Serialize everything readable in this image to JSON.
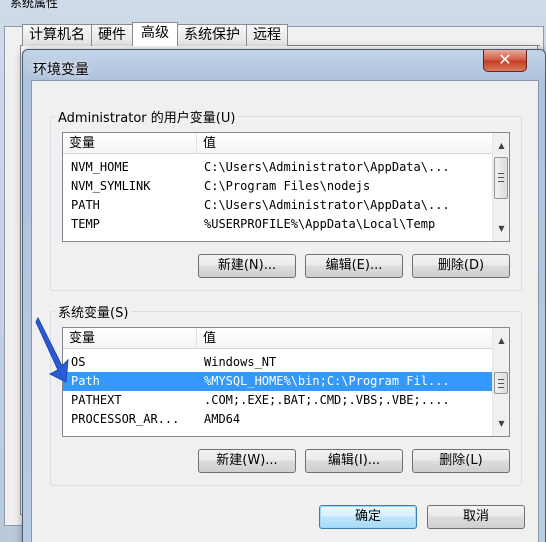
{
  "background_window": {
    "title": "系统属性",
    "tabs": [
      "计算机名",
      "硬件",
      "高级",
      "系统保护",
      "远程"
    ],
    "active_tab": "高级"
  },
  "dialog": {
    "title": "环境变量",
    "close_label": "✕",
    "user_vars": {
      "label": "Administrator 的用户变量(U)",
      "headers": {
        "name": "变量",
        "value": "值"
      },
      "rows": [
        {
          "name": "NVM_HOME",
          "value": "C:\\Users\\Administrator\\AppData\\..."
        },
        {
          "name": "NVM_SYMLINK",
          "value": "C:\\Program Files\\nodejs"
        },
        {
          "name": "PATH",
          "value": "C:\\Users\\Administrator\\AppData\\..."
        },
        {
          "name": "TEMP",
          "value": "%USERPROFILE%\\AppData\\Local\\Temp"
        }
      ],
      "buttons": {
        "new": "新建(N)...",
        "edit": "编辑(E)...",
        "delete": "删除(D)"
      }
    },
    "system_vars": {
      "label": "系统变量(S)",
      "headers": {
        "name": "变量",
        "value": "值"
      },
      "rows": [
        {
          "name": "OS",
          "value": "Windows_NT"
        },
        {
          "name": "Path",
          "value": "%MYSQL_HOME%\\bin;C:\\Program Fil..."
        },
        {
          "name": "PATHEXT",
          "value": ".COM;.EXE;.BAT;.CMD;.VBS;.VBE;...."
        },
        {
          "name": "PROCESSOR_AR...",
          "value": "AMD64"
        }
      ],
      "selected_row": "Path",
      "buttons": {
        "new": "新建(W)...",
        "edit": "编辑(I)...",
        "delete": "删除(L)"
      }
    },
    "ok_label": "确定",
    "cancel_label": "取消"
  },
  "colors": {
    "selection": "#3399ff",
    "pointer": "#2a5bd7"
  }
}
